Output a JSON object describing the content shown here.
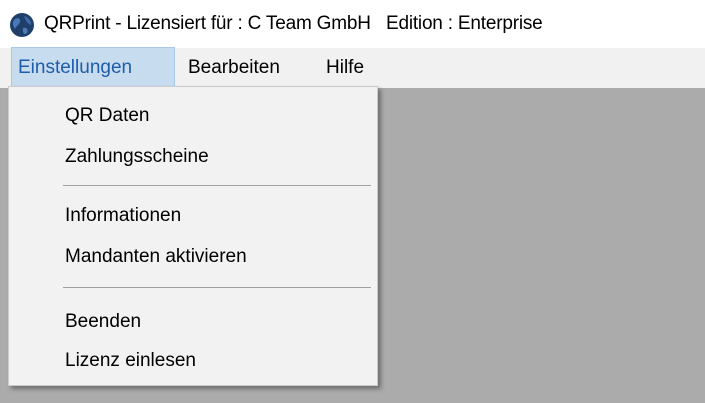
{
  "window": {
    "title": "QRPrint - Lizensiert für : C Team GmbH   Edition : Enterprise",
    "icon": "globe-icon"
  },
  "menubar": {
    "items": [
      {
        "label": "Einstellungen",
        "active": true
      },
      {
        "label": "Bearbeiten"
      },
      {
        "label": "Hilfe"
      }
    ]
  },
  "dropdown": {
    "groups": [
      [
        "QR Daten",
        "Zahlungsscheine"
      ],
      [
        "Informationen",
        "Mandanten aktivieren"
      ],
      [
        "Beenden",
        "Lizenz einlesen"
      ]
    ]
  },
  "colors": {
    "workspace": "#ababab",
    "menu_highlight": "#c8dcf0",
    "menu_active_text": "#1e5da8"
  }
}
